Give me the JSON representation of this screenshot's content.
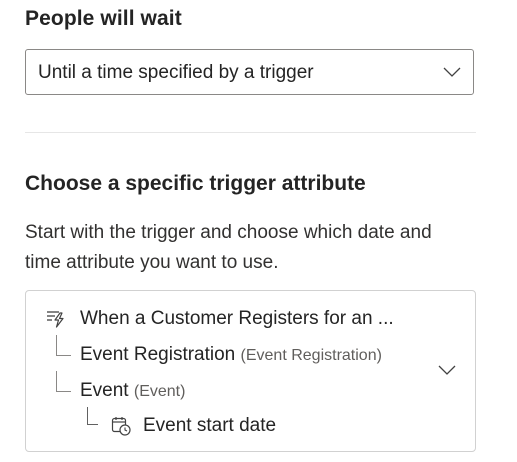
{
  "wait_section": {
    "label": "People will wait",
    "dropdown": {
      "selected": "Until a time specified by a trigger",
      "icon": "chevron-down-icon"
    }
  },
  "trigger_attribute_section": {
    "title": "Choose a specific trigger attribute",
    "description": "Start with the trigger and choose which date and time attribute you want to use.",
    "tree": {
      "trigger": {
        "label": "When a Customer Registers for an ...",
        "icon": "trigger-icon"
      },
      "entities": [
        {
          "label": "Event Registration",
          "type": "(Event Registration)"
        },
        {
          "label": "Event",
          "type": "(Event)"
        }
      ],
      "attribute": {
        "label": "Event start date",
        "icon": "calendar-clock-icon"
      },
      "expand_icon": "chevron-down-icon"
    }
  },
  "colors": {
    "text_primary": "#242424",
    "text_secondary": "#605e5c",
    "border": "#8a8886",
    "divider": "#e6e6e6"
  }
}
